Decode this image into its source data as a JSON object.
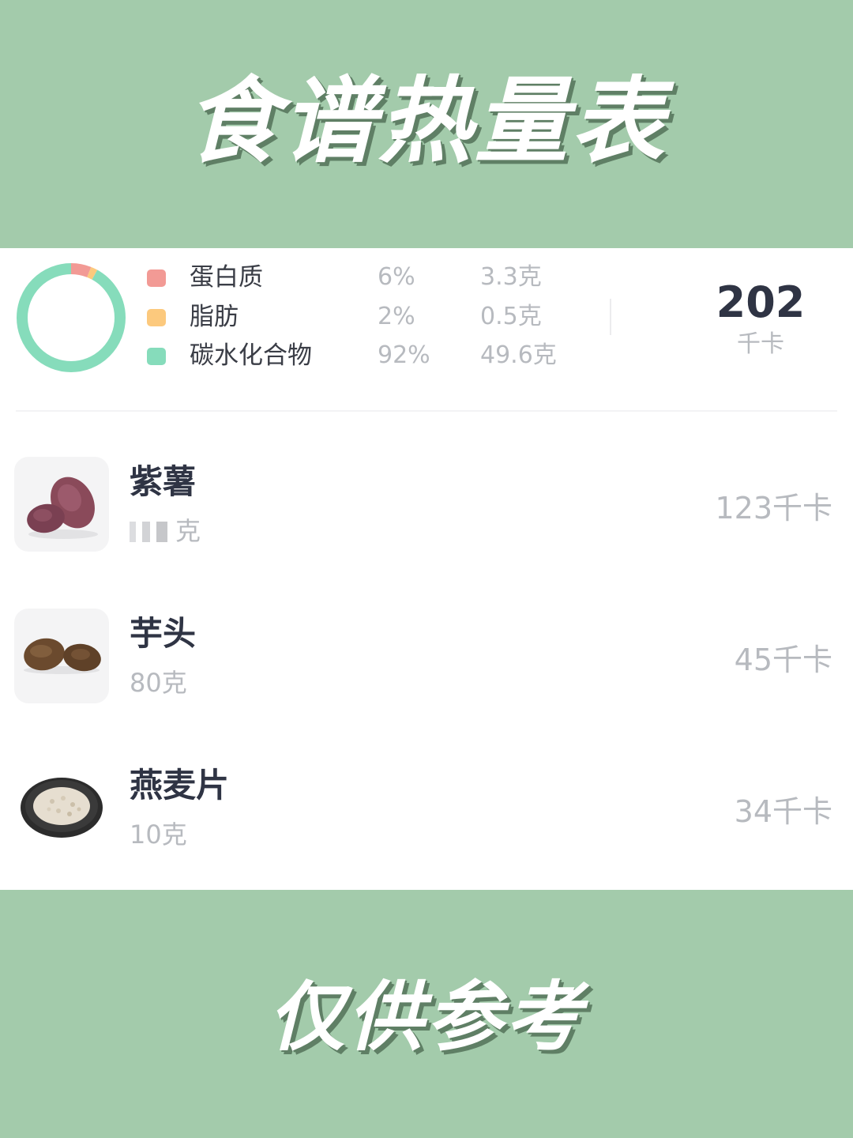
{
  "header": {
    "title": "食谱热量表"
  },
  "footer": {
    "title": "仅供参考"
  },
  "nutrition": {
    "items": [
      {
        "name": "蛋白质",
        "percent": "6%",
        "amount": "3.3克",
        "color": "#f29a95",
        "fraction": 0.06
      },
      {
        "name": "脂肪",
        "percent": "2%",
        "amount": "0.5克",
        "color": "#fcc97d",
        "fraction": 0.02
      },
      {
        "name": "碳水化合物",
        "percent": "92%",
        "amount": "49.6克",
        "color": "#86dcbb",
        "fraction": 0.92
      }
    ],
    "total_value": "202",
    "total_unit": "千卡"
  },
  "foods": [
    {
      "name": "紫薯",
      "weight_suffix": "克",
      "weight_value_obscured": true,
      "calories": "123千卡",
      "icon": "purple-sweet-potato-image"
    },
    {
      "name": "芋头",
      "weight": "80克",
      "calories": "45千卡",
      "icon": "taro-image"
    },
    {
      "name": "燕麦片",
      "weight": "10克",
      "calories": "34千卡",
      "icon": "oat-flakes-image"
    }
  ],
  "colors": {
    "background_green": "#a3cbab",
    "panel": "#ffffff",
    "primary_text": "#2f3444",
    "secondary_text": "#b7babf"
  }
}
